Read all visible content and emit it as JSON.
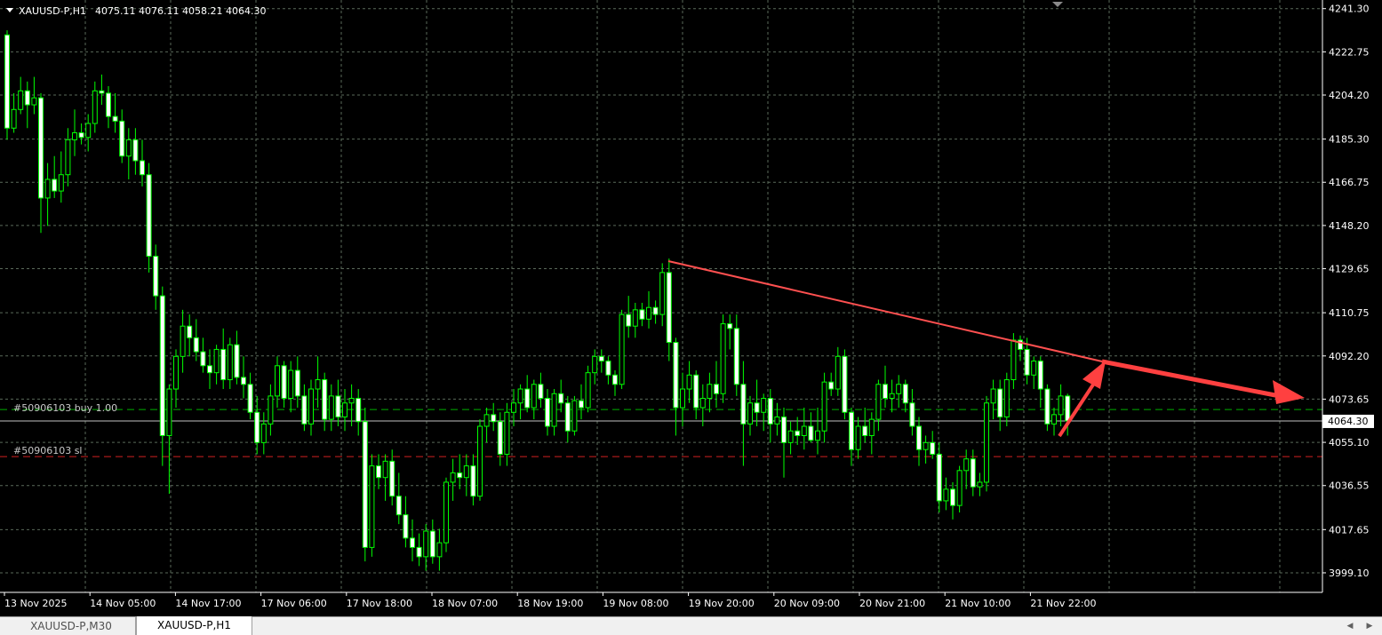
{
  "header": {
    "symbol_timeframe": "XAUUSD-P,H1",
    "ohlc": "4075.11 4076.11 4058.21 4064.30",
    "menu_icon": "triangle-down-icon"
  },
  "orders": {
    "buy_label": "#50906103 buy 1.00",
    "buy_price": 4069.2,
    "sl_label": "#50906103 sl",
    "sl_price": 4049.0
  },
  "current_price_label": "4064.30",
  "tabs": [
    {
      "label": "XAUUSD-P,M30",
      "active": false
    },
    {
      "label": "XAUUSD-P,H1",
      "active": true
    }
  ],
  "scroll": {
    "left_icon": "◀",
    "right_icon": "▶"
  },
  "colors": {
    "background": "#000000",
    "candle": "#00ff00",
    "grid": "#5a6a5a",
    "buy_line": "#00b000",
    "sl_line": "#d02020",
    "bid_line": "#c0c0c0",
    "arrow": "#ff5050"
  },
  "chart_data": {
    "type": "candlestick",
    "symbol": "XAUUSD-P",
    "timeframe": "H1",
    "ylim": [
      3990.7,
      4245.0
    ],
    "y_ticks": [
      "4241.30",
      "4222.75",
      "4204.20",
      "4185.30",
      "4166.75",
      "4148.20",
      "4129.65",
      "4110.75",
      "4092.20",
      "4073.65",
      "4055.10",
      "4036.55",
      "4017.65",
      "3999.10"
    ],
    "x_tick_labels": [
      "13 Nov 2025",
      "14 Nov 05:00",
      "14 Nov 17:00",
      "17 Nov 06:00",
      "17 Nov 18:00",
      "18 Nov 07:00",
      "18 Nov 19:00",
      "19 Nov 08:00",
      "19 Nov 20:00",
      "20 Nov 09:00",
      "20 Nov 21:00",
      "21 Nov 10:00",
      "21 Nov 22:00"
    ],
    "grid": true,
    "candles": [
      [
        4230.0,
        4232.0,
        4185.0,
        4190.0
      ],
      [
        4190.0,
        4205.0,
        4188.0,
        4198.0
      ],
      [
        4198.0,
        4212.0,
        4196.0,
        4206.0
      ],
      [
        4206.0,
        4210.0,
        4190.0,
        4200.0
      ],
      [
        4200.0,
        4212.0,
        4196.0,
        4203.0
      ],
      [
        4203.0,
        4205.0,
        4145.0,
        4160.0
      ],
      [
        4160.0,
        4175.0,
        4148.0,
        4168.0
      ],
      [
        4168.0,
        4178.0,
        4160.0,
        4163.0
      ],
      [
        4163.0,
        4180.0,
        4158.0,
        4170.0
      ],
      [
        4170.0,
        4190.0,
        4165.0,
        4185.0
      ],
      [
        4185.0,
        4198.0,
        4178.0,
        4188.0
      ],
      [
        4188.0,
        4192.0,
        4183.0,
        4186.0
      ],
      [
        4186.0,
        4196.0,
        4180.0,
        4192.0
      ],
      [
        4192.0,
        4210.0,
        4188.0,
        4206.0
      ],
      [
        4206.0,
        4213.0,
        4200.0,
        4205.0
      ],
      [
        4205.0,
        4208.0,
        4190.0,
        4195.0
      ],
      [
        4195.0,
        4205.0,
        4188.0,
        4193.0
      ],
      [
        4193.0,
        4198.0,
        4175.0,
        4178.0
      ],
      [
        4178.0,
        4190.0,
        4168.0,
        4185.0
      ],
      [
        4185.0,
        4190.0,
        4170.0,
        4176.0
      ],
      [
        4176.0,
        4185.0,
        4165.0,
        4170.0
      ],
      [
        4170.0,
        4175.0,
        4128.0,
        4135.0
      ],
      [
        4135.0,
        4140.0,
        4112.0,
        4118.0
      ],
      [
        4118.0,
        4122.0,
        4045.0,
        4058.0
      ],
      [
        4058.0,
        4080.0,
        4033.0,
        4078.0
      ],
      [
        4078.0,
        4095.0,
        4070.0,
        4092.0
      ],
      [
        4092.0,
        4112.0,
        4085.0,
        4105.0
      ],
      [
        4105.0,
        4110.0,
        4092.0,
        4100.0
      ],
      [
        4100.0,
        4108.0,
        4090.0,
        4094.0
      ],
      [
        4094.0,
        4100.0,
        4085.0,
        4088.0
      ],
      [
        4088.0,
        4095.0,
        4078.0,
        4085.0
      ],
      [
        4085.0,
        4097.0,
        4080.0,
        4095.0
      ],
      [
        4095.0,
        4104.0,
        4078.0,
        4082.0
      ],
      [
        4082.0,
        4100.0,
        4078.0,
        4097.0
      ],
      [
        4097.0,
        4103.0,
        4080.0,
        4083.0
      ],
      [
        4083.0,
        4092.0,
        4074.0,
        4080.0
      ],
      [
        4080.0,
        4085.0,
        4065.0,
        4068.0
      ],
      [
        4068.0,
        4075.0,
        4050.0,
        4055.0
      ],
      [
        4055.0,
        4068.0,
        4050.0,
        4063.0
      ],
      [
        4063.0,
        4080.0,
        4058.0,
        4075.0
      ],
      [
        4075.0,
        4092.0,
        4070.0,
        4088.0
      ],
      [
        4088.0,
        4090.0,
        4070.0,
        4074.0
      ],
      [
        4074.0,
        4090.0,
        4068.0,
        4086.0
      ],
      [
        4086.0,
        4092.0,
        4070.0,
        4075.0
      ],
      [
        4075.0,
        4080.0,
        4060.0,
        4063.0
      ],
      [
        4063.0,
        4082.0,
        4058.0,
        4078.0
      ],
      [
        4078.0,
        4092.0,
        4070.0,
        4082.0
      ],
      [
        4082.0,
        4085.0,
        4060.0,
        4065.0
      ],
      [
        4065.0,
        4080.0,
        4060.0,
        4075.0
      ],
      [
        4075.0,
        4082.0,
        4062.0,
        4066.0
      ],
      [
        4066.0,
        4078.0,
        4060.0,
        4072.0
      ],
      [
        4072.0,
        4080.0,
        4062.0,
        4074.0
      ],
      [
        4074.0,
        4078.0,
        4058.0,
        4064.0
      ],
      [
        4064.0,
        4070.0,
        4004.0,
        4010.0
      ],
      [
        4010.0,
        4050.0,
        4006.0,
        4045.0
      ],
      [
        4045.0,
        4050.0,
        4035.0,
        4040.0
      ],
      [
        4040.0,
        4050.0,
        4030.0,
        4047.0
      ],
      [
        4047.0,
        4052.0,
        4028.0,
        4032.0
      ],
      [
        4032.0,
        4042.0,
        4020.0,
        4024.0
      ],
      [
        4024.0,
        4032.0,
        4010.0,
        4014.0
      ],
      [
        4014.0,
        4022.0,
        4004.0,
        4010.0
      ],
      [
        4010.0,
        4016.0,
        4002.0,
        4006.0
      ],
      [
        4006.0,
        4020.0,
        4000.0,
        4017.0
      ],
      [
        4017.0,
        4022.0,
        4003.0,
        4006.0
      ],
      [
        4006.0,
        4018.0,
        4000.0,
        4012.0
      ],
      [
        4012.0,
        4040.0,
        4008.0,
        4038.0
      ],
      [
        4038.0,
        4048.0,
        4030.0,
        4042.0
      ],
      [
        4042.0,
        4050.0,
        4035.0,
        4040.0
      ],
      [
        4040.0,
        4050.0,
        4032.0,
        4045.0
      ],
      [
        4045.0,
        4050.0,
        4028.0,
        4032.0
      ],
      [
        4032.0,
        4065.0,
        4030.0,
        4062.0
      ],
      [
        4062.0,
        4070.0,
        4055.0,
        4067.0
      ],
      [
        4067.0,
        4072.0,
        4060.0,
        4064.0
      ],
      [
        4064.0,
        4068.0,
        4045.0,
        4050.0
      ],
      [
        4050.0,
        4072.0,
        4045.0,
        4068.0
      ],
      [
        4068.0,
        4078.0,
        4062.0,
        4072.0
      ],
      [
        4072.0,
        4080.0,
        4065.0,
        4078.0
      ],
      [
        4078.0,
        4084.0,
        4068.0,
        4070.0
      ],
      [
        4070.0,
        4082.0,
        4065.0,
        4080.0
      ],
      [
        4080.0,
        4085.0,
        4070.0,
        4074.0
      ],
      [
        4074.0,
        4078.0,
        4058.0,
        4062.0
      ],
      [
        4062.0,
        4078.0,
        4058.0,
        4076.0
      ],
      [
        4076.0,
        4082.0,
        4068.0,
        4072.0
      ],
      [
        4072.0,
        4075.0,
        4055.0,
        4060.0
      ],
      [
        4060.0,
        4075.0,
        4058.0,
        4073.0
      ],
      [
        4073.0,
        4080.0,
        4065.0,
        4070.0
      ],
      [
        4070.0,
        4088.0,
        4068.0,
        4085.0
      ],
      [
        4085.0,
        4095.0,
        4080.0,
        4092.0
      ],
      [
        4092.0,
        4095.0,
        4085.0,
        4090.0
      ],
      [
        4090.0,
        4092.0,
        4080.0,
        4084.0
      ],
      [
        4084.0,
        4086.0,
        4075.0,
        4080.0
      ],
      [
        4080.0,
        4112.0,
        4078.0,
        4110.0
      ],
      [
        4110.0,
        4118.0,
        4100.0,
        4105.0
      ],
      [
        4105.0,
        4115.0,
        4100.0,
        4112.0
      ],
      [
        4112.0,
        4115.0,
        4105.0,
        4108.0
      ],
      [
        4108.0,
        4120.0,
        4104.0,
        4113.0
      ],
      [
        4113.0,
        4116.0,
        4106.0,
        4110.0
      ],
      [
        4110.0,
        4132.0,
        4105.0,
        4128.0
      ],
      [
        4128.0,
        4134.0,
        4090.0,
        4098.0
      ],
      [
        4098.0,
        4100.0,
        4058.0,
        4070.0
      ],
      [
        4070.0,
        4085.0,
        4062.0,
        4078.0
      ],
      [
        4078.0,
        4090.0,
        4072.0,
        4084.0
      ],
      [
        4084.0,
        4086.0,
        4065.0,
        4070.0
      ],
      [
        4070.0,
        4080.0,
        4062.0,
        4074.0
      ],
      [
        4074.0,
        4085.0,
        4068.0,
        4080.0
      ],
      [
        4080.0,
        4090.0,
        4070.0,
        4076.0
      ],
      [
        4076.0,
        4110.0,
        4072.0,
        4106.0
      ],
      [
        4106.0,
        4110.0,
        4095.0,
        4104.0
      ],
      [
        4104.0,
        4110.0,
        4075.0,
        4080.0
      ],
      [
        4080.0,
        4090.0,
        4045.0,
        4063.0
      ],
      [
        4063.0,
        4075.0,
        4058.0,
        4072.0
      ],
      [
        4072.0,
        4082.0,
        4062.0,
        4068.0
      ],
      [
        4068.0,
        4076.0,
        4060.0,
        4074.0
      ],
      [
        4074.0,
        4078.0,
        4055.0,
        4063.0
      ],
      [
        4063.0,
        4072.0,
        4058.0,
        4066.0
      ],
      [
        4066.0,
        4070.0,
        4040.0,
        4055.0
      ],
      [
        4055.0,
        4064.0,
        4050.0,
        4060.0
      ],
      [
        4060.0,
        4066.0,
        4054.0,
        4058.0
      ],
      [
        4058.0,
        4070.0,
        4052.0,
        4062.0
      ],
      [
        4062.0,
        4068.0,
        4055.0,
        4056.0
      ],
      [
        4056.0,
        4070.0,
        4050.0,
        4060.0
      ],
      [
        4060.0,
        4085.0,
        4055.0,
        4081.0
      ],
      [
        4081.0,
        4085.0,
        4075.0,
        4078.0
      ],
      [
        4078.0,
        4096.0,
        4075.0,
        4092.0
      ],
      [
        4092.0,
        4095.0,
        4065.0,
        4068.0
      ],
      [
        4068.0,
        4070.0,
        4045.0,
        4052.0
      ],
      [
        4052.0,
        4066.0,
        4048.0,
        4062.0
      ],
      [
        4062.0,
        4070.0,
        4055.0,
        4058.0
      ],
      [
        4058.0,
        4068.0,
        4050.0,
        4065.0
      ],
      [
        4065.0,
        4082.0,
        4060.0,
        4080.0
      ],
      [
        4080.0,
        4088.0,
        4070.0,
        4074.0
      ],
      [
        4074.0,
        4082.0,
        4068.0,
        4076.0
      ],
      [
        4076.0,
        4084.0,
        4070.0,
        4080.0
      ],
      [
        4080.0,
        4082.0,
        4068.0,
        4072.0
      ],
      [
        4072.0,
        4078.0,
        4058.0,
        4062.0
      ],
      [
        4062.0,
        4066.0,
        4045.0,
        4052.0
      ],
      [
        4052.0,
        4058.0,
        4046.0,
        4055.0
      ],
      [
        4055.0,
        4060.0,
        4048.0,
        4050.0
      ],
      [
        4050.0,
        4055.0,
        4025.0,
        4030.0
      ],
      [
        4030.0,
        4040.0,
        4026.0,
        4035.0
      ],
      [
        4035.0,
        4038.0,
        4022.0,
        4028.0
      ],
      [
        4028.0,
        4045.0,
        4025.0,
        4043.0
      ],
      [
        4043.0,
        4052.0,
        4035.0,
        4048.0
      ],
      [
        4048.0,
        4052.0,
        4032.0,
        4036.0
      ],
      [
        4036.0,
        4042.0,
        4032.0,
        4038.0
      ],
      [
        4038.0,
        4075.0,
        4034.0,
        4072.0
      ],
      [
        4072.0,
        4082.0,
        4065.0,
        4078.0
      ],
      [
        4078.0,
        4082.0,
        4060.0,
        4066.0
      ],
      [
        4066.0,
        4085.0,
        4062.0,
        4082.0
      ],
      [
        4082.0,
        4102.0,
        4078.0,
        4099.0
      ],
      [
        4099.0,
        4101.0,
        4090.0,
        4095.0
      ],
      [
        4095.0,
        4100.0,
        4080.0,
        4084.0
      ],
      [
        4084.0,
        4092.0,
        4078.0,
        4090.0
      ],
      [
        4090.0,
        4092.0,
        4070.0,
        4078.0
      ],
      [
        4078.0,
        4080.0,
        4060.0,
        4063.0
      ],
      [
        4063.0,
        4070.0,
        4058.0,
        4067.0
      ],
      [
        4067.0,
        4080.0,
        4062.0,
        4075.0
      ],
      [
        4075.0,
        4076.0,
        4058.0,
        4064.3
      ]
    ]
  }
}
